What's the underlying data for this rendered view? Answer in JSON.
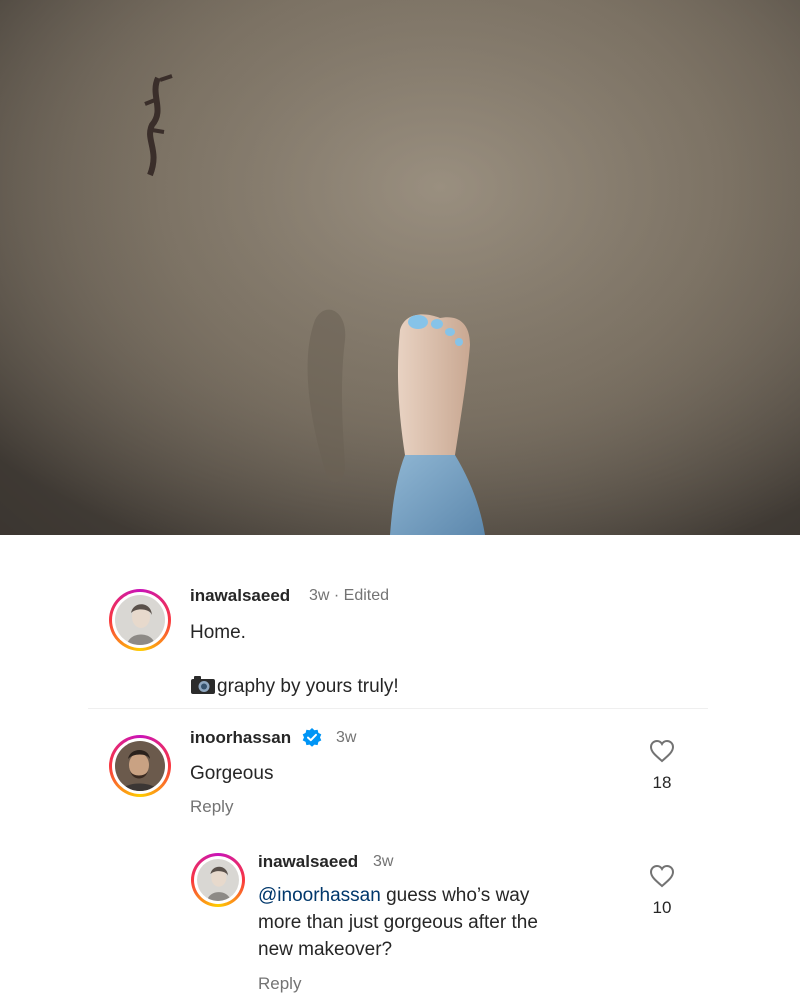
{
  "photo": {
    "alt_icon": "sand-footprint-photo"
  },
  "caption": {
    "username": "inawalsaeed",
    "meta": "3w · Edited",
    "line1": "Home.",
    "line2": "graphy by yours truly!",
    "emoji": "camera-icon"
  },
  "comments": [
    {
      "username": "inoorhassan",
      "verified": true,
      "time": "3w",
      "text": "Gorgeous",
      "reply_label": "Reply",
      "likes": "18"
    }
  ],
  "replies": [
    {
      "username": "inawalsaeed",
      "time": "3w",
      "mention": "@inoorhassan",
      "text_line1": " guess who’s way",
      "text_line2": "more than just gorgeous after the",
      "text_line3": "new makeover?",
      "reply_label": "Reply",
      "likes": "10"
    }
  ],
  "colors": {
    "mention": "#00376b",
    "verified": "#0095f6",
    "muted": "#737373"
  }
}
